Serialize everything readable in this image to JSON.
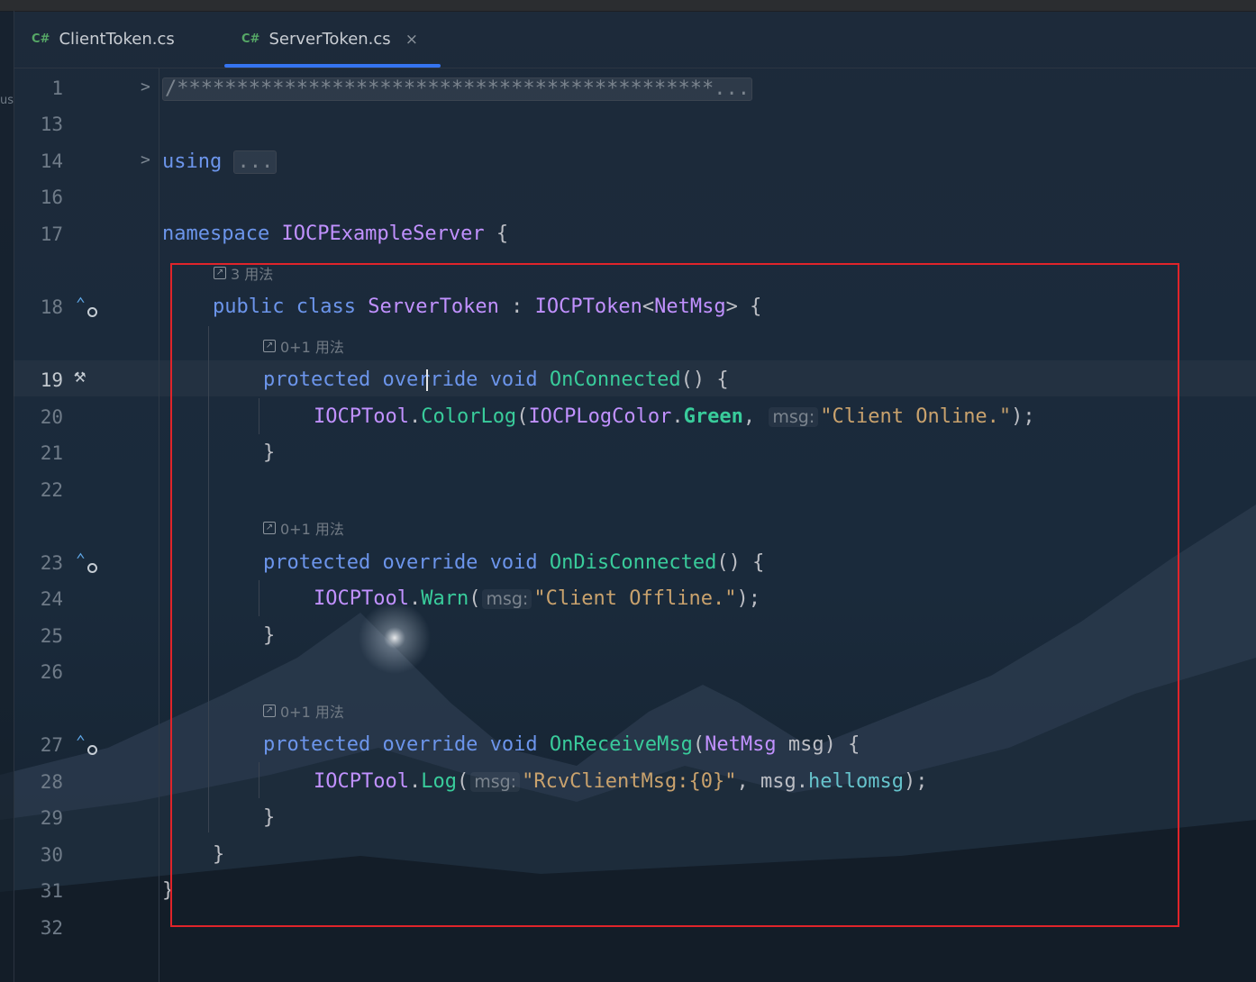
{
  "tabs": [
    {
      "lang": "C#",
      "label": "ClientToken.cs",
      "active": false
    },
    {
      "lang": "C#",
      "label": "ServerToken.cs",
      "active": true,
      "close": "×"
    }
  ],
  "left_panel_text": "us",
  "inlay_hint_param": "msg:",
  "usages": {
    "class": "3 用法",
    "method1": "0+1 用法",
    "method2": "0+1 用法",
    "method3": "0+1 用法"
  },
  "lines": [
    {
      "n": "1",
      "text": "/*********************************************..."
    },
    {
      "n": "13",
      "text": ""
    },
    {
      "n": "14",
      "text": "using",
      "folded": "..."
    },
    {
      "n": "16",
      "text": ""
    },
    {
      "n": "17",
      "text": "namespace IOCPExampleServer {"
    },
    {
      "n": "18",
      "text": "public class ServerToken : IOCPToken<NetMsg> {"
    },
    {
      "n": "19",
      "text": "protected override void OnConnected() {"
    },
    {
      "n": "20",
      "text": "IOCPTool.ColorLog(IOCPLogColor.Green, \"Client Online.\");"
    },
    {
      "n": "21",
      "text": "}"
    },
    {
      "n": "22",
      "text": ""
    },
    {
      "n": "23",
      "text": "protected override void OnDisConnected() {"
    },
    {
      "n": "24",
      "text": "IOCPTool.Warn(\"Client Offline.\");"
    },
    {
      "n": "25",
      "text": "}"
    },
    {
      "n": "26",
      "text": ""
    },
    {
      "n": "27",
      "text": "protected override void OnReceiveMsg(NetMsg msg) {"
    },
    {
      "n": "28",
      "text": "IOCPTool.Log(\"RcvClientMsg:{0}\", msg.hellomsg);"
    },
    {
      "n": "29",
      "text": "}"
    },
    {
      "n": "30",
      "text": "}"
    },
    {
      "n": "31",
      "text": "}"
    },
    {
      "n": "32",
      "text": ""
    }
  ],
  "tokens": {
    "comment": "/*********************************************",
    "ellipsis": "...",
    "using": "using",
    "namespace": "namespace",
    "ns_name": "IOCPExampleServer",
    "public": "public",
    "class": "class",
    "class_name": "ServerToken",
    "colon": ":",
    "base": "IOCPToken",
    "lt": "<",
    "gt": ">",
    "netmsg": "NetMsg",
    "protected": "protected",
    "override": "override",
    "void": "void",
    "m1": "OnConnected",
    "m2": "OnDisConnected",
    "m3": "OnReceiveMsg",
    "parens_brace": "() {",
    "open_brace": "{",
    "close_brace": "}",
    "tool": "IOCPTool",
    "dot": ".",
    "colorlog": "ColorLog",
    "warn": "Warn",
    "log": "Log",
    "open_paren": "(",
    "logcolor": "IOCPLogColor",
    "green": "Green",
    "comma": ",",
    "str1": "\"Client Online.\"",
    "str2": "\"Client Offline.\"",
    "str3": "\"RcvClientMsg:{0}\"",
    "close_semicolon": ");",
    "msg": "msg",
    "close_paren_brace": ") {",
    "hellomsg": "hellomsg",
    "chevron": ">"
  },
  "colors": {
    "keyword": "#6c95eb",
    "class": "#c191ff",
    "method": "#39cc9b",
    "string": "#c9a26d",
    "highlight_box": "#e0242a",
    "tab_underline": "#3574f0"
  }
}
